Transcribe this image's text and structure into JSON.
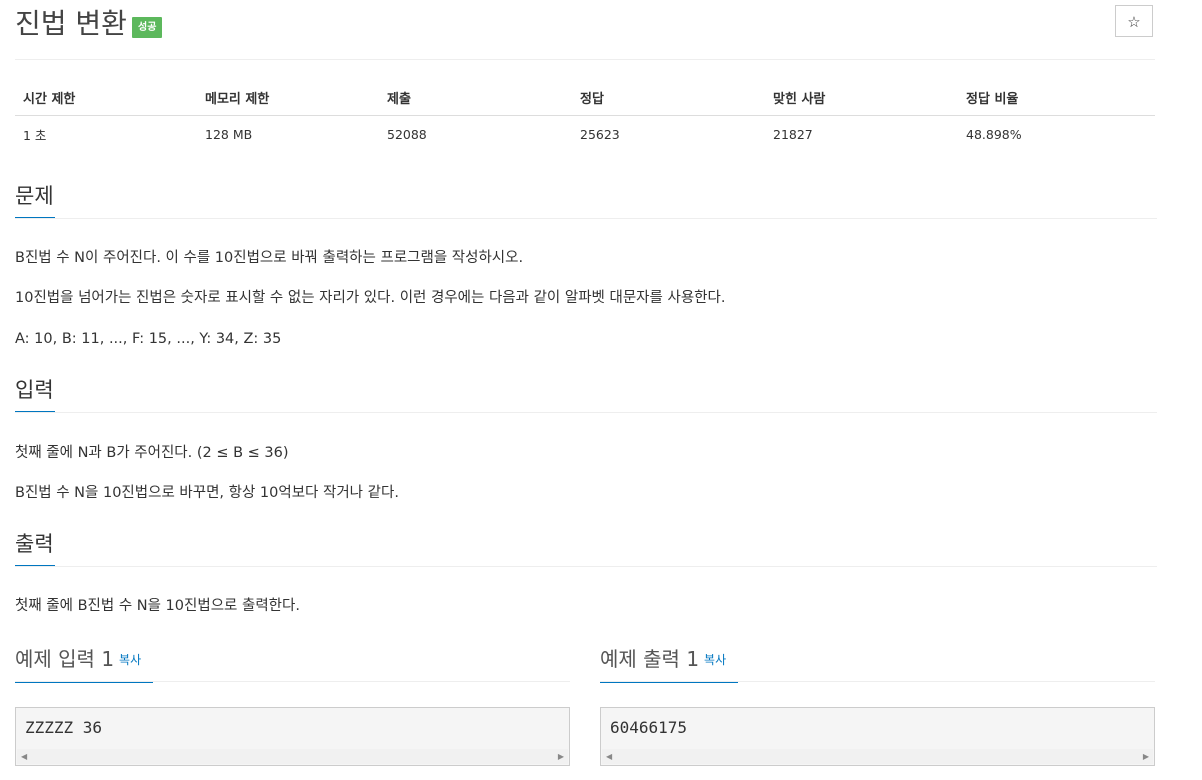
{
  "problem": {
    "title": "진법 변환",
    "badge": "성공",
    "star_icon": "☆"
  },
  "stats": {
    "headers": [
      "시간 제한",
      "메모리 제한",
      "제출",
      "정답",
      "맞힌 사람",
      "정답 비율"
    ],
    "values": [
      "1 초",
      "128 MB",
      "52088",
      "25623",
      "21827",
      "48.898%"
    ]
  },
  "sections": {
    "description": {
      "heading": "문제",
      "paragraphs": [
        "B진법 수 N이 주어진다. 이 수를 10진법으로 바꿔 출력하는 프로그램을 작성하시오.",
        "10진법을 넘어가는 진법은 숫자로 표시할 수 없는 자리가 있다. 이런 경우에는 다음과 같이 알파벳 대문자를 사용한다.",
        "A: 10, B: 11, ..., F: 15, ..., Y: 34, Z: 35"
      ]
    },
    "input": {
      "heading": "입력",
      "paragraphs": [
        "첫째 줄에 N과 B가 주어진다. (2 ≤ B ≤ 36)",
        "B진법 수 N을 10진법으로 바꾸면, 항상 10억보다 작거나 같다."
      ]
    },
    "output": {
      "heading": "출력",
      "paragraphs": [
        "첫째 줄에 B진법 수 N을 10진법으로 출력한다."
      ]
    }
  },
  "samples": {
    "input": {
      "heading": "예제 입력 1",
      "copy_label": "복사",
      "content": "ZZZZZ 36"
    },
    "output": {
      "heading": "예제 출력 1",
      "copy_label": "복사",
      "content": "60466175"
    }
  }
}
